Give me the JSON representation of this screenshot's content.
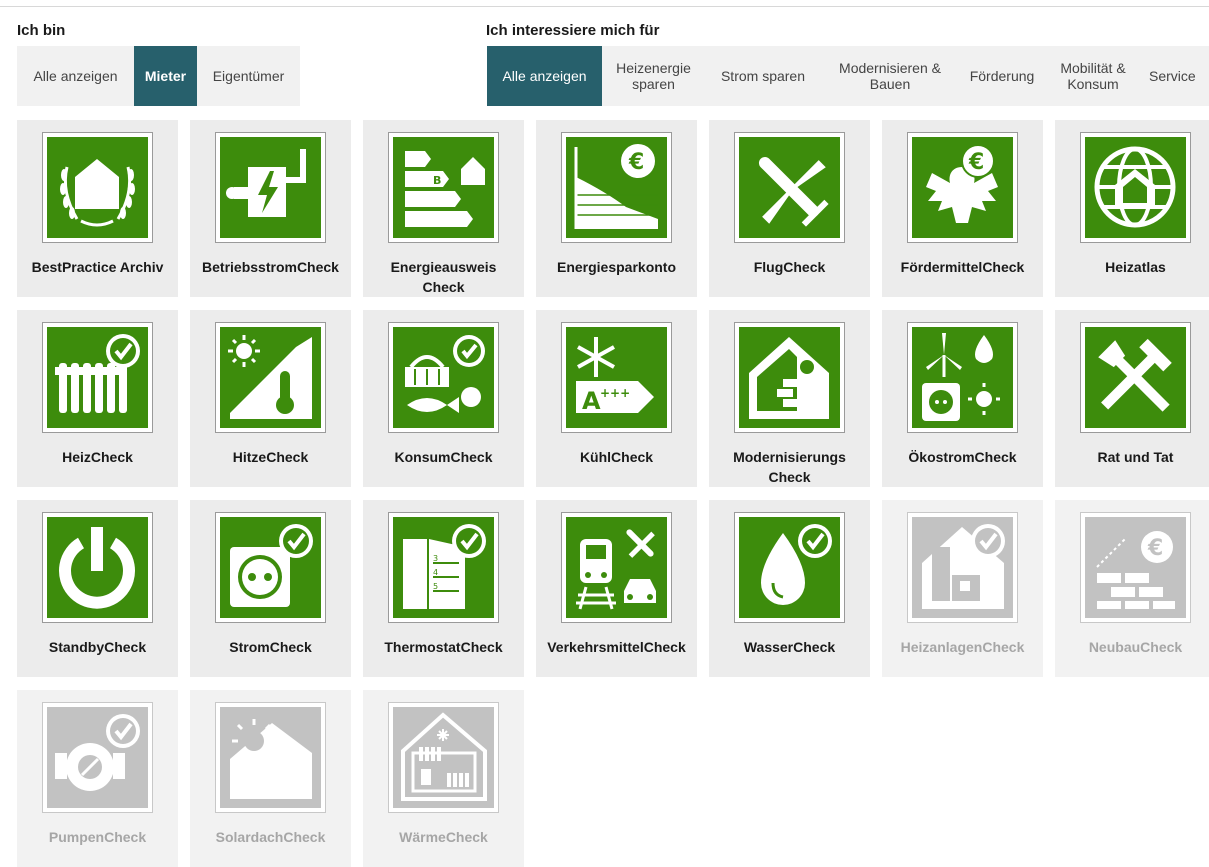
{
  "colors": {
    "accent": "#27606c",
    "icon_green": "#3d8c0c",
    "icon_disabled": "#c2c2c2"
  },
  "i_am": {
    "title": "Ich bin",
    "buttons": [
      {
        "label": "Alle anzeigen",
        "active": false
      },
      {
        "label": "Mieter",
        "active": true
      },
      {
        "label": "Eigentümer",
        "active": false
      }
    ]
  },
  "interests": {
    "title": "Ich interessiere mich für",
    "buttons": [
      {
        "label": "Alle anzeigen",
        "active": true
      },
      {
        "label": "Heizenergie\nsparen",
        "active": false
      },
      {
        "label": "Strom sparen",
        "active": false
      },
      {
        "label": "Modernisieren &\nBauen",
        "active": false
      },
      {
        "label": "Förderung",
        "active": false
      },
      {
        "label": "Mobilität &\nKonsum",
        "active": false
      },
      {
        "label": "Service",
        "active": false
      }
    ]
  },
  "tools": [
    {
      "label": "BestPractice Archiv",
      "icon": "laurel-house-icon",
      "enabled": true
    },
    {
      "label": "BetriebsstromCheck",
      "icon": "power-pipe-icon",
      "enabled": true
    },
    {
      "label": "Energieausweis\nCheck",
      "icon": "energy-label-icon",
      "enabled": true
    },
    {
      "label": "Energiesparkonto",
      "icon": "euro-chart-icon",
      "enabled": true
    },
    {
      "label": "FlugCheck",
      "icon": "airplane-icon",
      "enabled": true
    },
    {
      "label": "FördermittelCheck",
      "icon": "eagle-euro-icon",
      "enabled": true
    },
    {
      "label": "Heizatlas",
      "icon": "globe-house-icon",
      "enabled": true
    },
    {
      "label": "HeizCheck",
      "icon": "radiator-check-icon",
      "enabled": true
    },
    {
      "label": "HitzeCheck",
      "icon": "sun-thermometer-icon",
      "enabled": true
    },
    {
      "label": "KonsumCheck",
      "icon": "basket-fish-icon",
      "enabled": true
    },
    {
      "label": "KühlCheck",
      "icon": "snowflake-label-icon",
      "enabled": true
    },
    {
      "label": "Modernisierungs\nCheck",
      "icon": "house-bricks-icon",
      "enabled": true
    },
    {
      "label": "ÖkostromCheck",
      "icon": "wind-socket-icon",
      "enabled": true
    },
    {
      "label": "Rat und Tat",
      "icon": "tools-icon",
      "enabled": true
    },
    {
      "label": "StandbyCheck",
      "icon": "power-icon",
      "enabled": true
    },
    {
      "label": "StromCheck",
      "icon": "socket-check-icon",
      "enabled": true
    },
    {
      "label": "ThermostatCheck",
      "icon": "thermostat-check-icon",
      "enabled": true
    },
    {
      "label": "VerkehrsmittelCheck",
      "icon": "transport-icon",
      "enabled": true
    },
    {
      "label": "WasserCheck",
      "icon": "water-drop-check-icon",
      "enabled": true
    },
    {
      "label": "HeizanlagenCheck",
      "icon": "heating-system-check-icon",
      "enabled": false
    },
    {
      "label": "NeubauCheck",
      "icon": "new-building-euro-icon",
      "enabled": false
    },
    {
      "label": "PumpenCheck",
      "icon": "pump-check-icon",
      "enabled": false
    },
    {
      "label": "SolardachCheck",
      "icon": "solar-roof-icon",
      "enabled": false
    },
    {
      "label": "WärmeCheck",
      "icon": "house-heating-icon",
      "enabled": false
    }
  ]
}
